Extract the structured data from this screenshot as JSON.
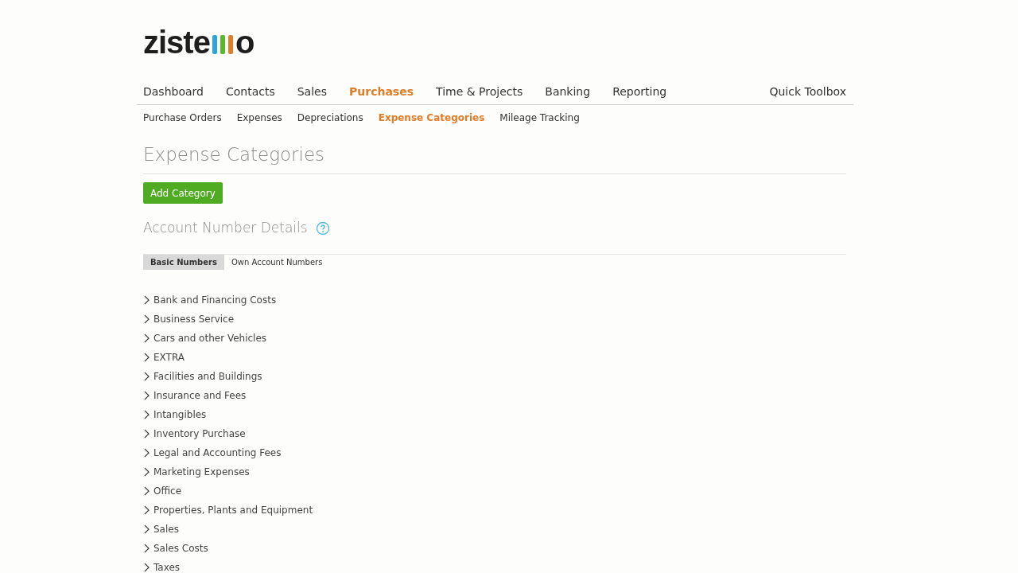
{
  "logo": {
    "text_start": "ziste",
    "text_end": "o"
  },
  "main_nav": [
    {
      "label": "Dashboard",
      "selected": false
    },
    {
      "label": "Contacts",
      "selected": false
    },
    {
      "label": "Sales",
      "selected": false
    },
    {
      "label": "Purchases",
      "selected": true
    },
    {
      "label": "Time & Projects",
      "selected": false
    },
    {
      "label": "Banking",
      "selected": false
    },
    {
      "label": "Reporting",
      "selected": false
    }
  ],
  "quick_toolbox": "Quick Toolbox",
  "sub_nav": [
    {
      "label": "Purchase Orders",
      "selected": false
    },
    {
      "label": "Expenses",
      "selected": false
    },
    {
      "label": "Depreciations",
      "selected": false
    },
    {
      "label": "Expense Categories",
      "selected": true
    },
    {
      "label": "Mileage Tracking",
      "selected": false
    }
  ],
  "page_title": "Expense Categories",
  "add_button": "Add Category",
  "section_title": "Account Number Details",
  "tabs": [
    {
      "label": "Basic Numbers",
      "selected": true
    },
    {
      "label": "Own Account Numbers",
      "selected": false
    }
  ],
  "categories": [
    {
      "label": "Bank and Financing Costs",
      "expanded": false
    },
    {
      "label": "Business Service",
      "expanded": false
    },
    {
      "label": "Cars and other Vehicles",
      "expanded": false
    },
    {
      "label": "EXTRA",
      "expanded": false
    },
    {
      "label": "Facilities and Buildings",
      "expanded": false
    },
    {
      "label": "Insurance and Fees",
      "expanded": false
    },
    {
      "label": "Intangibles",
      "expanded": false
    },
    {
      "label": "Inventory Purchase",
      "expanded": false
    },
    {
      "label": "Legal and Accounting Fees",
      "expanded": false
    },
    {
      "label": "Marketing Expenses",
      "expanded": false
    },
    {
      "label": "Office",
      "expanded": false
    },
    {
      "label": "Properties, Plants and Equipment",
      "expanded": false
    },
    {
      "label": "Sales",
      "expanded": false
    },
    {
      "label": "Sales Costs",
      "expanded": false
    },
    {
      "label": "Taxes",
      "expanded": false
    }
  ]
}
